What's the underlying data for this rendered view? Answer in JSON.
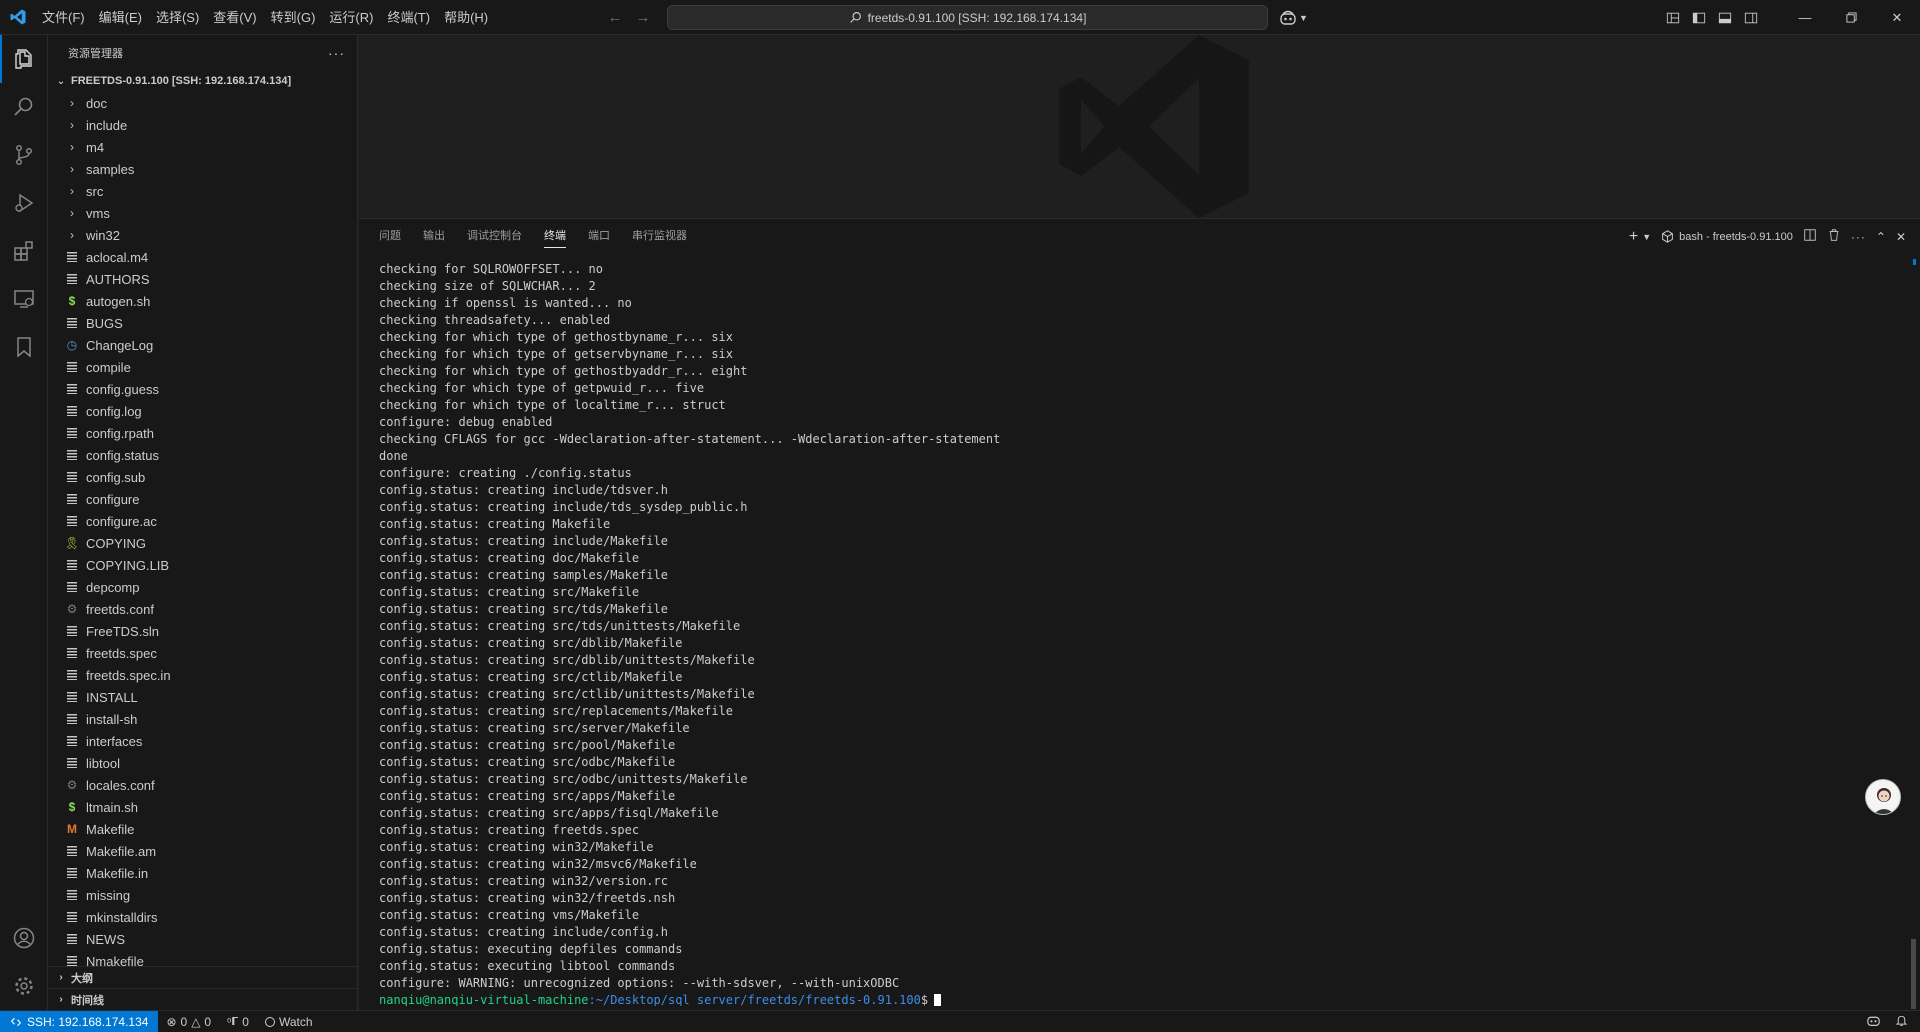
{
  "titlebar": {
    "menu": [
      "文件(F)",
      "编辑(E)",
      "选择(S)",
      "查看(V)",
      "转到(G)",
      "运行(R)",
      "终端(T)",
      "帮助(H)"
    ],
    "search_text": "freetds-0.91.100 [SSH: 192.168.174.134]"
  },
  "sidebar": {
    "title": "资源管理器",
    "root": "FREETDS-0.91.100 [SSH: 192.168.174.134]",
    "items": [
      {
        "label": "doc",
        "icon": "chevron-right-icon",
        "kind": "folder"
      },
      {
        "label": "include",
        "icon": "chevron-right-icon",
        "kind": "folder"
      },
      {
        "label": "m4",
        "icon": "chevron-right-icon",
        "kind": "folder"
      },
      {
        "label": "samples",
        "icon": "chevron-right-icon",
        "kind": "folder"
      },
      {
        "label": "src",
        "icon": "chevron-right-icon",
        "kind": "folder"
      },
      {
        "label": "vms",
        "icon": "chevron-right-icon",
        "kind": "folder"
      },
      {
        "label": "win32",
        "icon": "chevron-right-icon",
        "kind": "folder"
      },
      {
        "label": "aclocal.m4",
        "icon": "lines-file-icon",
        "kind": "file"
      },
      {
        "label": "AUTHORS",
        "icon": "lines-file-icon",
        "kind": "file"
      },
      {
        "label": "autogen.sh",
        "icon": "shell-file-icon",
        "kind": "file"
      },
      {
        "label": "BUGS",
        "icon": "lines-file-icon",
        "kind": "file"
      },
      {
        "label": "ChangeLog",
        "icon": "changelog-file-icon",
        "kind": "file"
      },
      {
        "label": "compile",
        "icon": "lines-file-icon",
        "kind": "file"
      },
      {
        "label": "config.guess",
        "icon": "lines-file-icon",
        "kind": "file"
      },
      {
        "label": "config.log",
        "icon": "lines-file-icon",
        "kind": "file"
      },
      {
        "label": "config.rpath",
        "icon": "lines-file-icon",
        "kind": "file"
      },
      {
        "label": "config.status",
        "icon": "lines-file-icon",
        "kind": "file"
      },
      {
        "label": "config.sub",
        "icon": "lines-file-icon",
        "kind": "file"
      },
      {
        "label": "configure",
        "icon": "lines-file-icon",
        "kind": "file"
      },
      {
        "label": "configure.ac",
        "icon": "lines-file-icon",
        "kind": "file"
      },
      {
        "label": "COPYING",
        "icon": "license-file-icon",
        "kind": "file"
      },
      {
        "label": "COPYING.LIB",
        "icon": "lines-file-icon",
        "kind": "file"
      },
      {
        "label": "depcomp",
        "icon": "lines-file-icon",
        "kind": "file"
      },
      {
        "label": "freetds.conf",
        "icon": "gear-file-icon",
        "kind": "file"
      },
      {
        "label": "FreeTDS.sln",
        "icon": "lines-file-icon",
        "kind": "file"
      },
      {
        "label": "freetds.spec",
        "icon": "lines-file-icon",
        "kind": "file"
      },
      {
        "label": "freetds.spec.in",
        "icon": "lines-file-icon",
        "kind": "file"
      },
      {
        "label": "INSTALL",
        "icon": "lines-file-icon",
        "kind": "file"
      },
      {
        "label": "install-sh",
        "icon": "lines-file-icon",
        "kind": "file"
      },
      {
        "label": "interfaces",
        "icon": "lines-file-icon",
        "kind": "file"
      },
      {
        "label": "libtool",
        "icon": "lines-file-icon",
        "kind": "file"
      },
      {
        "label": "locales.conf",
        "icon": "gear-file-icon",
        "kind": "file"
      },
      {
        "label": "ltmain.sh",
        "icon": "shell-file-icon",
        "kind": "file"
      },
      {
        "label": "Makefile",
        "icon": "makefile-icon",
        "kind": "file"
      },
      {
        "label": "Makefile.am",
        "icon": "lines-file-icon",
        "kind": "file"
      },
      {
        "label": "Makefile.in",
        "icon": "lines-file-icon",
        "kind": "file"
      },
      {
        "label": "missing",
        "icon": "lines-file-icon",
        "kind": "file"
      },
      {
        "label": "mkinstalldirs",
        "icon": "lines-file-icon",
        "kind": "file"
      },
      {
        "label": "NEWS",
        "icon": "lines-file-icon",
        "kind": "file"
      },
      {
        "label": "Nmakefile",
        "icon": "lines-file-icon",
        "kind": "file"
      }
    ],
    "sections": [
      "大纲",
      "时间线"
    ]
  },
  "panel": {
    "tabs": [
      "问题",
      "输出",
      "调试控制台",
      "终端",
      "端口",
      "串行监视器"
    ],
    "active_tab": "终端",
    "terminal_name": "bash - freetds-0.91.100",
    "lines": [
      "checking for SQLROWOFFSET... no",
      "checking size of SQLWCHAR... 2",
      "checking if openssl is wanted... no",
      "checking threadsafety... enabled",
      "checking for which type of gethostbyname_r... six",
      "checking for which type of getservbyname_r... six",
      "checking for which type of gethostbyaddr_r... eight",
      "checking for which type of getpwuid_r... five",
      "checking for which type of localtime_r... struct",
      "configure: debug enabled",
      "checking CFLAGS for gcc -Wdeclaration-after-statement... -Wdeclaration-after-statement",
      "done",
      "configure: creating ./config.status",
      "config.status: creating include/tdsver.h",
      "config.status: creating include/tds_sysdep_public.h",
      "config.status: creating Makefile",
      "config.status: creating include/Makefile",
      "config.status: creating doc/Makefile",
      "config.status: creating samples/Makefile",
      "config.status: creating src/Makefile",
      "config.status: creating src/tds/Makefile",
      "config.status: creating src/tds/unittests/Makefile",
      "config.status: creating src/dblib/Makefile",
      "config.status: creating src/dblib/unittests/Makefile",
      "config.status: creating src/ctlib/Makefile",
      "config.status: creating src/ctlib/unittests/Makefile",
      "config.status: creating src/replacements/Makefile",
      "config.status: creating src/server/Makefile",
      "config.status: creating src/pool/Makefile",
      "config.status: creating src/odbc/Makefile",
      "config.status: creating src/odbc/unittests/Makefile",
      "config.status: creating src/apps/Makefile",
      "config.status: creating src/apps/fisql/Makefile",
      "config.status: creating freetds.spec",
      "config.status: creating win32/Makefile",
      "config.status: creating win32/msvc6/Makefile",
      "config.status: creating win32/version.rc",
      "config.status: creating win32/freetds.nsh",
      "config.status: creating vms/Makefile",
      "config.status: creating include/config.h",
      "config.status: executing depfiles commands",
      "config.status: executing libtool commands",
      "configure: WARNING: unrecognized options: --with-sdsver, --with-unixODBC"
    ],
    "prompt_user": "nanqiu@nanqiu-virtual-machine",
    "prompt_path": ":~/Desktop/sql_server/freetds/freetds-0.91.100",
    "prompt_symbol": "$"
  },
  "statusbar": {
    "remote": "SSH: 192.168.174.134",
    "errors": "0",
    "warnings": "0",
    "ports": "0",
    "watch": "Watch"
  },
  "colors": {
    "accent": "#0078d4",
    "prompt_user": "#23d18b",
    "prompt_path": "#3b8eea"
  }
}
